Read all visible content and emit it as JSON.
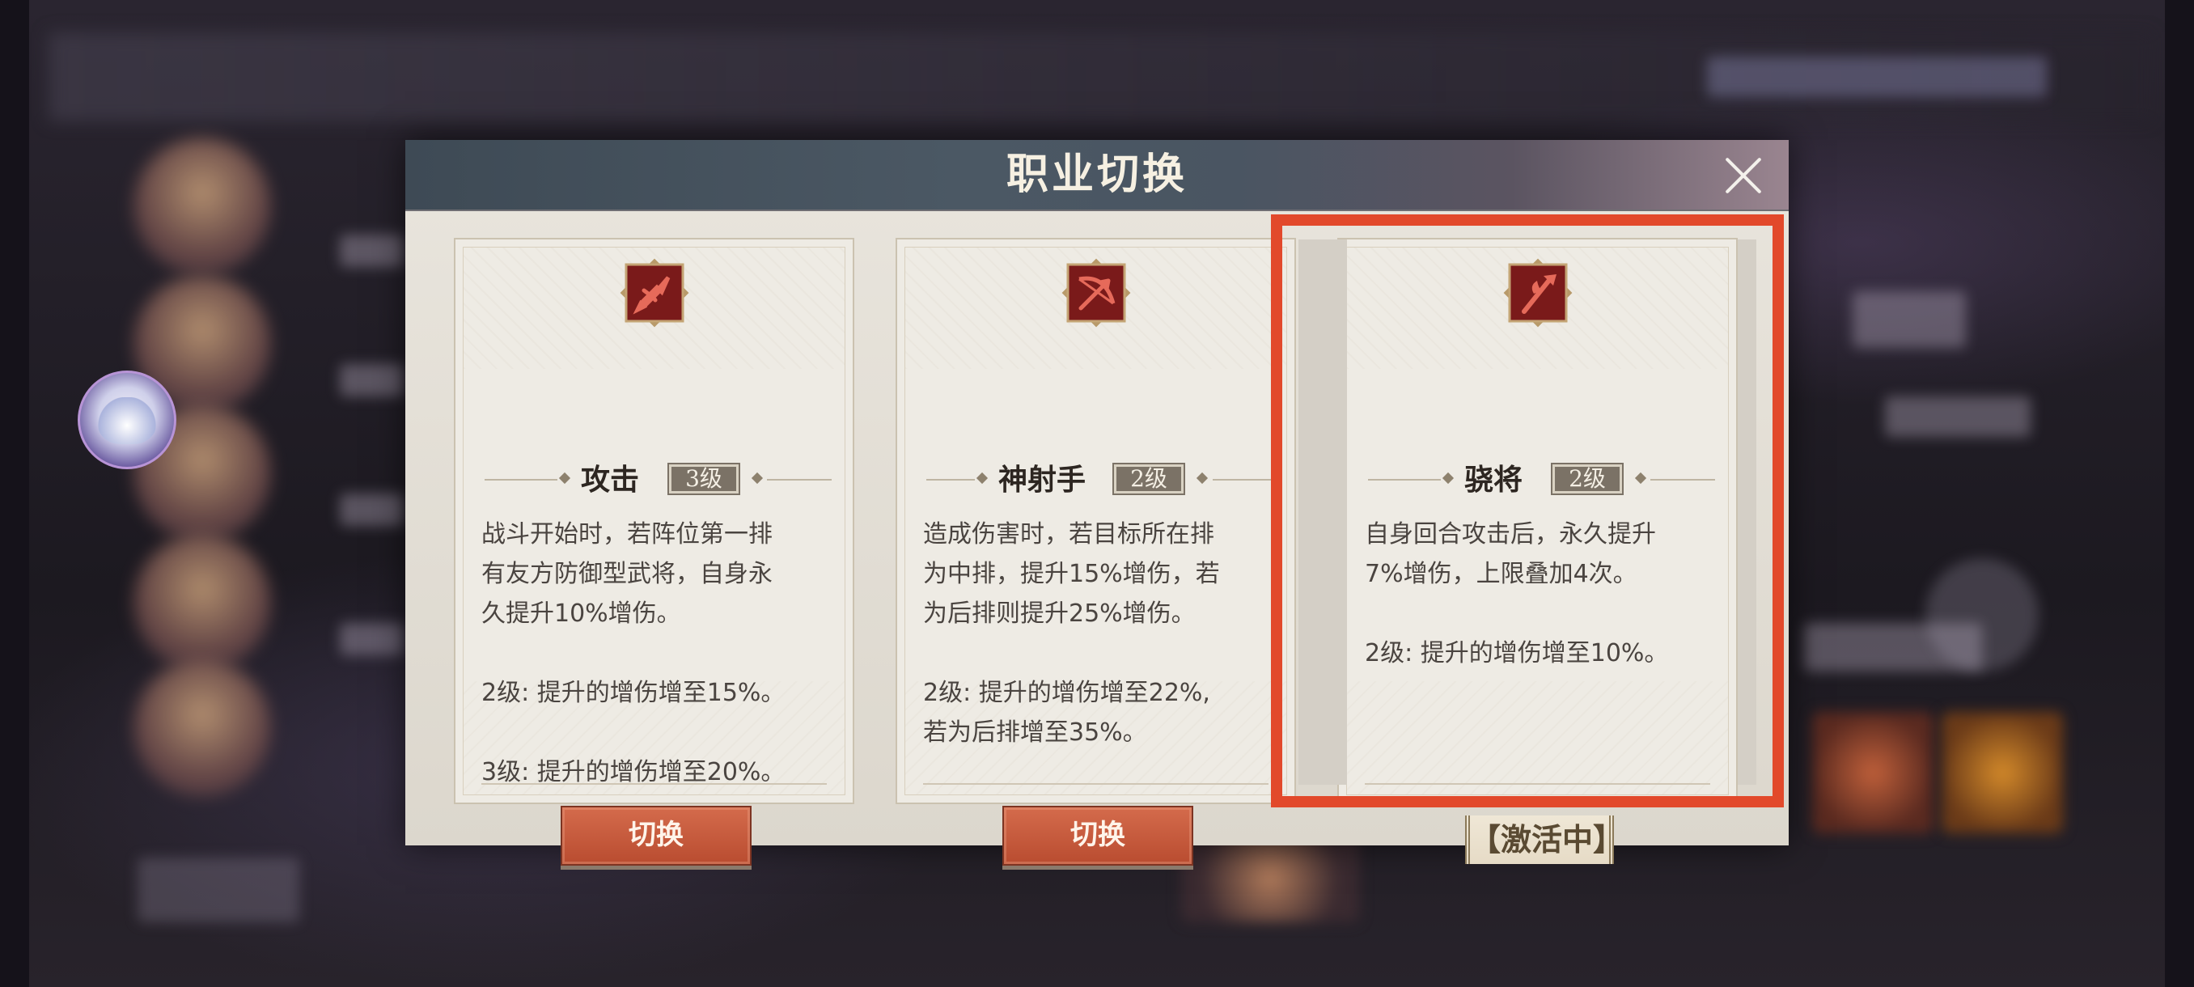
{
  "modal": {
    "title": "职业切换",
    "close_icon": "close-icon"
  },
  "cards": [
    {
      "name": "攻击",
      "level": "3级",
      "icon": "sword-emblem-icon",
      "description": "战斗开始时，若阵位第一排\n有友方防御型武将，自身永\n久提升10%增伤。\n\n2级: 提升的增伤增至15%。\n\n3级: 提升的增伤增至20%。",
      "button_label": "切换"
    },
    {
      "name": "神射手",
      "level": "2级",
      "icon": "bow-emblem-icon",
      "description": "造成伤害时，若目标所在排\n为中排，提升15%增伤，若\n为后排则提升25%增伤。\n\n2级: 提升的增伤增至22%,\n若为后排增至35%。",
      "button_label": "切换"
    },
    {
      "name": "骁将",
      "level": "2级",
      "icon": "halberd-emblem-icon",
      "description": "自身回合攻击后，永久提升\n7%增伤，上限叠加4次。\n\n2级: 提升的增伤增至10%。",
      "status_label": "【激活中】"
    }
  ],
  "colors": {
    "accent_red": "#e2492b",
    "button_orange": "#c85a3c",
    "emblem_dark_red": "#7a1a1a",
    "header_slate": "#4b5864"
  }
}
